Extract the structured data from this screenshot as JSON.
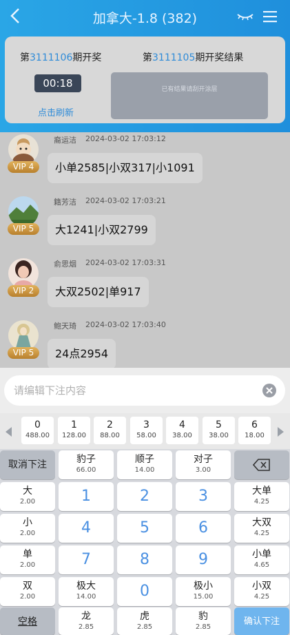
{
  "header": {
    "title": "加拿大-1.8 (382)",
    "current_draw": {
      "prefix": "第",
      "period": "3111106",
      "suffix": "期开奖"
    },
    "last_draw": {
      "prefix": "第",
      "period": "3111105",
      "suffix": "期开奖结果"
    },
    "countdown": "00:18",
    "refresh_label": "点击刷新",
    "scratch_hint": "已有结果请刮开涂层"
  },
  "messages": [
    {
      "name": "裔运洁",
      "time": "2024-03-02 17:03:12",
      "vip": "VIP 4",
      "text": "小单2585|小双317|小1091"
    },
    {
      "name": "籍芳洁",
      "time": "2024-03-02 17:03:21",
      "vip": "VIP 5",
      "text": "大1241|小双2799"
    },
    {
      "name": "俞思烟",
      "time": "2024-03-02 17:03:31",
      "vip": "VIP 2",
      "text": "大双2502|单917"
    },
    {
      "name": "鲍天琦",
      "time": "2024-03-02 17:03:40",
      "vip": "VIP 5",
      "text": "24点2954"
    }
  ],
  "input": {
    "placeholder": "请编辑下注内容"
  },
  "sums": [
    {
      "n": "0",
      "odds": "488.00"
    },
    {
      "n": "1",
      "odds": "128.00"
    },
    {
      "n": "2",
      "odds": "88.00"
    },
    {
      "n": "3",
      "odds": "58.00"
    },
    {
      "n": "4",
      "odds": "38.00"
    },
    {
      "n": "5",
      "odds": "38.00"
    },
    {
      "n": "6",
      "odds": "18.00"
    }
  ],
  "keys": {
    "cancel": "取消下注",
    "baozi": {
      "l": "豹子",
      "o": "66.00"
    },
    "shunzi": {
      "l": "顺子",
      "o": "14.00"
    },
    "duizi": {
      "l": "对子",
      "o": "3.00"
    },
    "da": {
      "l": "大",
      "o": "2.00"
    },
    "xiao": {
      "l": "小",
      "o": "2.00"
    },
    "dan": {
      "l": "单",
      "o": "2.00"
    },
    "shuang": {
      "l": "双",
      "o": "2.00"
    },
    "dadan": {
      "l": "大单",
      "o": "4.25"
    },
    "dashuang": {
      "l": "大双",
      "o": "4.25"
    },
    "xiaodan": {
      "l": "小单",
      "o": "4.65"
    },
    "xiaoshuang": {
      "l": "小双",
      "o": "4.25"
    },
    "jida": {
      "l": "极大",
      "o": "14.00"
    },
    "jixiao": {
      "l": "极小",
      "o": "15.00"
    },
    "long": {
      "l": "龙",
      "o": "2.85"
    },
    "hu": {
      "l": "虎",
      "o": "2.85"
    },
    "bao": {
      "l": "豹",
      "o": "2.85"
    },
    "n1": "1",
    "n2": "2",
    "n3": "3",
    "n4": "4",
    "n5": "5",
    "n6": "6",
    "n7": "7",
    "n8": "8",
    "n9": "9",
    "n0": "0",
    "space": "空格",
    "confirm": "确认下注"
  },
  "colors": {
    "accent": "#2e8bd8",
    "header": "#2aa6e6",
    "confirm": "#6fb5ee",
    "vip": "#c8903a"
  }
}
